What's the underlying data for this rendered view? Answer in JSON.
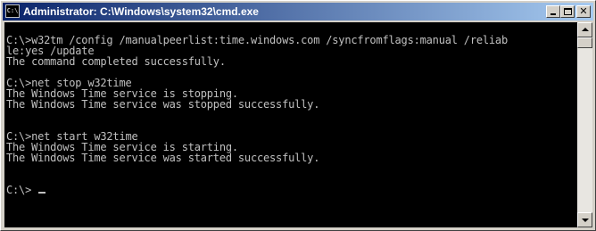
{
  "window": {
    "icon_text": "C:\\",
    "title": "Administrator: C:\\Windows\\system32\\cmd.exe",
    "minimize_label": "_",
    "maximize_label": "□",
    "close_label": "✕"
  },
  "console": {
    "lines": [
      "",
      "C:\\>w32tm /config /manualpeerlist:time.windows.com /syncfromflags:manual /reliab",
      "le:yes /update",
      "The command completed successfully.",
      "",
      "C:\\>net stop w32time",
      "The Windows Time service is stopping.",
      "The Windows Time service was stopped successfully.",
      "",
      "",
      "C:\\>net start w32time",
      "The Windows Time service is starting.",
      "The Windows Time service was started successfully.",
      "",
      "",
      "C:\\>"
    ],
    "colors": {
      "background": "#000000",
      "foreground": "#c0c0c0"
    }
  },
  "scrollbar": {
    "up_icon": "arrow-up-icon",
    "down_icon": "arrow-down-icon"
  },
  "colors": {
    "titlebar_start": "#0a246a",
    "titlebar_end": "#a6caf0",
    "chrome": "#d4d0c8"
  }
}
